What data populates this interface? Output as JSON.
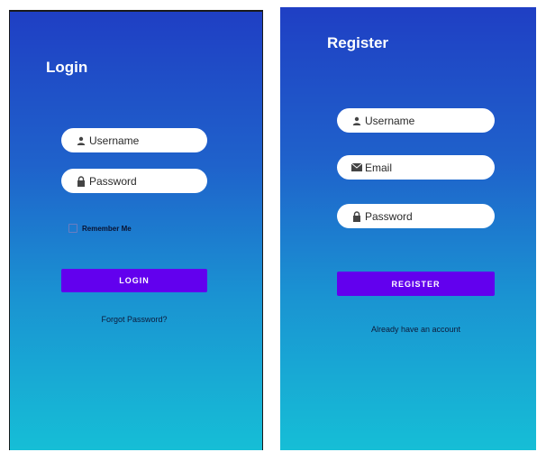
{
  "login": {
    "title": "Login",
    "username_placeholder": "Username",
    "password_placeholder": "Password",
    "remember_label": "Remember Me",
    "remember_checked": false,
    "login_label": "LOGIN",
    "forgot_label": "Forgot Password?"
  },
  "register": {
    "title": "Register",
    "username_placeholder": "Username",
    "email_placeholder": "Email",
    "password_placeholder": "Password",
    "register_label": "REGISTER",
    "account_link": "Already have an account"
  },
  "icons": {
    "username": "person-icon",
    "email": "envelope-icon",
    "password": "lock-icon"
  },
  "colors": {
    "button": "#6200ee",
    "gradient_top": "#1f3fc4",
    "gradient_bottom": "#16bed6"
  }
}
